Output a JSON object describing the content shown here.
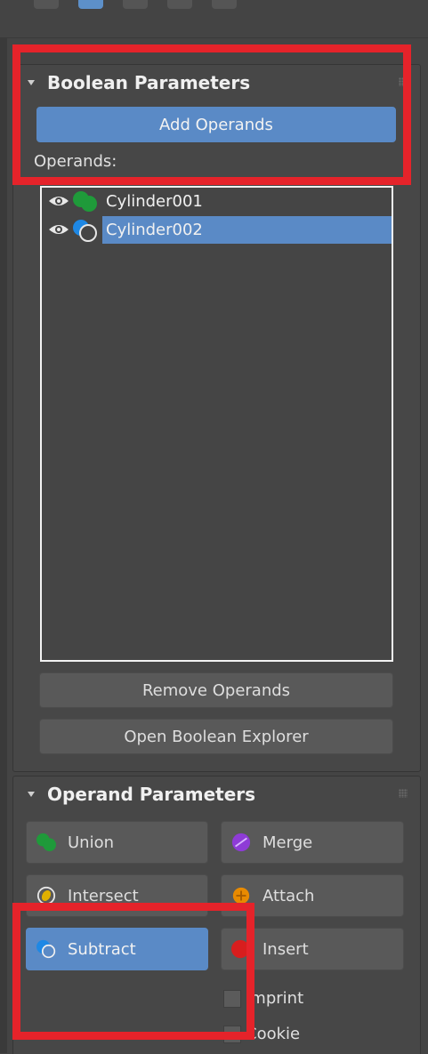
{
  "boolean_rollout": {
    "title": "Boolean Parameters",
    "add_operands_label": "Add Operands",
    "operands_label": "Operands:",
    "operands": [
      {
        "name": "Cylinder001",
        "selected": false,
        "icon": "union-icon"
      },
      {
        "name": "Cylinder002",
        "selected": true,
        "icon": "subtract-icon"
      }
    ],
    "remove_operands_label": "Remove Operands",
    "open_explorer_label": "Open Boolean Explorer"
  },
  "operand_rollout": {
    "title": "Operand Parameters",
    "union_label": "Union",
    "merge_label": "Merge",
    "intersect_label": "Intersect",
    "attach_label": "Attach",
    "subtract_label": "Subtract",
    "insert_label": "Insert",
    "imprint_label": "Imprint",
    "cookie_label": "Cookie",
    "active_operation": "Subtract"
  },
  "colors": {
    "accent": "#5a8ac6",
    "panel_bg": "#474747",
    "annotation": "#e5232a"
  }
}
